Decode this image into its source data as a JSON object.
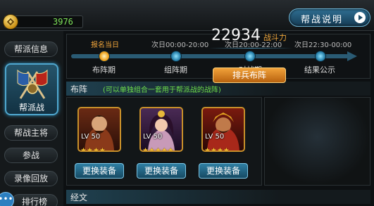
{
  "currency": {
    "value": "3976",
    "icon": "coin-icon"
  },
  "help_button": {
    "label": "帮战说明"
  },
  "sidebar": {
    "items": [
      {
        "label": "帮派信息"
      },
      {
        "label": "帮派战",
        "selected": true
      },
      {
        "label": "帮战主将"
      },
      {
        "label": "参战"
      },
      {
        "label": "录像回放"
      },
      {
        "label": "排行榜"
      }
    ],
    "dots": "•••"
  },
  "timeline": {
    "stages": [
      {
        "time": "报名当日",
        "phase": "布阵期",
        "current": true
      },
      {
        "time": "次日00:00-20:00",
        "phase": "组阵期"
      },
      {
        "time": "次日20:00-22:00",
        "phase": "对战期"
      },
      {
        "time": "次日22:30-00:00",
        "phase": "结果公示"
      }
    ]
  },
  "deploy": {
    "title": "布阵",
    "hint": "(可以单独组合一套用于帮派战的战阵)",
    "heroes": [
      {
        "level": "LV 50",
        "stars": 4
      },
      {
        "level": "LV 50",
        "stars": 5
      },
      {
        "level": "LV 50",
        "stars": 4
      }
    ],
    "equip_label": "更换装备",
    "power_value": "22934",
    "power_label": "战斗力",
    "arrange_label": "排兵布阵"
  },
  "scripture": {
    "title": "经文"
  },
  "colors": {
    "accent_blue": "#2f7fa3",
    "accent_orange": "#f1a23a",
    "hint_green": "#6fe04b",
    "currency_green": "#7fe45a"
  }
}
